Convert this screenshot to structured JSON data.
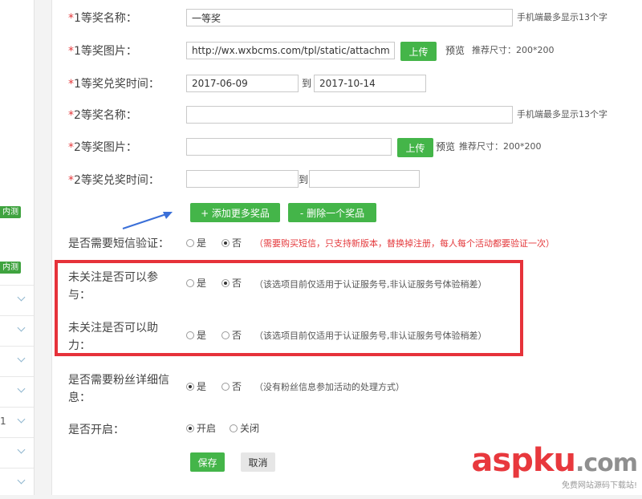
{
  "sidebar": {
    "badge1": "内测",
    "badge2": "内测",
    "row_number": "1"
  },
  "form": {
    "prize1_name": {
      "label": "1等奖名称：",
      "value": "一等奖",
      "hint": "手机端最多显示13个字"
    },
    "prize1_image": {
      "label": "1等奖图片：",
      "value": "http://wx.wxbcms.com/tpl/static/attachment",
      "upload": "上传",
      "preview": "预览",
      "hint": "推荐尺寸：200*200"
    },
    "prize1_time": {
      "label": "1等奖兑奖时间：",
      "start": "2017-06-09",
      "to": "到",
      "end": "2017-10-14"
    },
    "prize2_name": {
      "label": "2等奖名称：",
      "value": "",
      "hint": "手机端最多显示13个字"
    },
    "prize2_image": {
      "label": "2等奖图片：",
      "value": "",
      "upload": "上传",
      "preview": "预览",
      "hint": "推荐尺寸：200*200"
    },
    "prize2_time": {
      "label": "2等奖兑奖时间：",
      "start": "",
      "to": "到",
      "end": ""
    },
    "required_mark": "*",
    "add_more": "+ 添加更多奖品",
    "delete_one": "- 删除一个奖品",
    "sms": {
      "label": "是否需要短信验证：",
      "yes": "是",
      "no": "否",
      "selected": "no",
      "note": "（需要购买短信，只支持新版本，替换掉注册，每人每个活动都要验证一次）"
    },
    "unfollow_join": {
      "label_line1": "未关注是否可以参",
      "label_line2": "与：",
      "yes": "是",
      "no": "否",
      "selected": "no",
      "note": "（该选项目前仅适用于认证服务号,非认证服务号体验稍差）"
    },
    "unfollow_help": {
      "label_line1": "未关注是否可以助",
      "label_line2": "力：",
      "yes": "是",
      "no": "否",
      "selected": "none",
      "note": "（该选项目前仅适用于认证服务号,非认证服务号体验稍差）"
    },
    "fans_info": {
      "label_line1": "是否需要粉丝详细信",
      "label_line2": "息：",
      "yes": "是",
      "no": "否",
      "selected": "yes",
      "note": "（没有粉丝信息参加活动的处理方式）"
    },
    "enable": {
      "label": "是否开启：",
      "on": "开启",
      "off": "关闭",
      "selected": "on"
    },
    "save": "保存",
    "cancel": "取消"
  },
  "colors": {
    "accent_green": "#44b549",
    "required_red": "#e4393c",
    "highlight_red": "#e6323a",
    "arrow_blue": "#3a6fd8"
  },
  "watermark": {
    "main": "asp",
    "ku": "ku",
    "tail": ".com",
    "sub": "免费网站源码下载站!"
  }
}
